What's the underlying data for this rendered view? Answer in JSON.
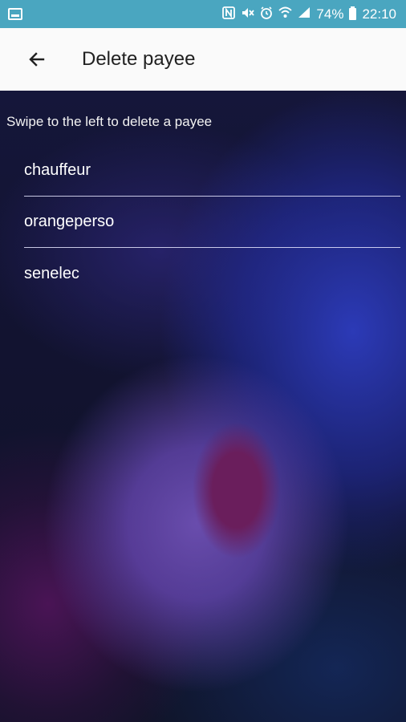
{
  "status_bar": {
    "battery": "74%",
    "time": "22:10",
    "icons": [
      "gallery-icon",
      "nfc-icon",
      "mute-icon",
      "alarm-icon",
      "wifi-icon",
      "signal-icon",
      "battery-icon"
    ]
  },
  "toolbar": {
    "back_icon": "arrow-left-icon",
    "title": "Delete payee"
  },
  "content": {
    "hint": "Swipe to the left to delete a payee",
    "payees": [
      {
        "label": "chauffeur"
      },
      {
        "label": "orangeperso"
      },
      {
        "label": "senelec"
      }
    ]
  },
  "colors": {
    "status_bar": "#4aa6c0",
    "toolbar": "#fafafa",
    "text_on_bg": "#ffffff"
  }
}
